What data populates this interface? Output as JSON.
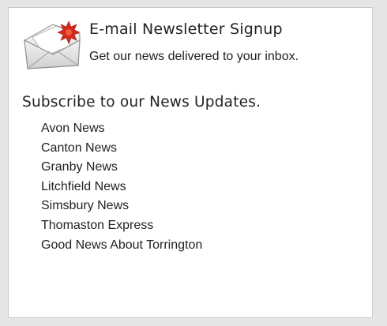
{
  "signup": {
    "icon": "envelope-icon",
    "title": "E-mail Newsletter Signup",
    "subtitle": "Get our news delivered to your inbox."
  },
  "subscribe": {
    "heading": "Subscribe to our News Updates.",
    "items": [
      "Avon News",
      "Canton News",
      "Granby News",
      "Litchfield News",
      "Simsbury News",
      "Thomaston Express",
      "Good News About Torrington"
    ]
  },
  "colors": {
    "page_background": "#e6e6e6",
    "panel_background": "#ffffff",
    "panel_border": "#c9c9c9",
    "text": "#222222",
    "burst": "#d42a1e"
  }
}
